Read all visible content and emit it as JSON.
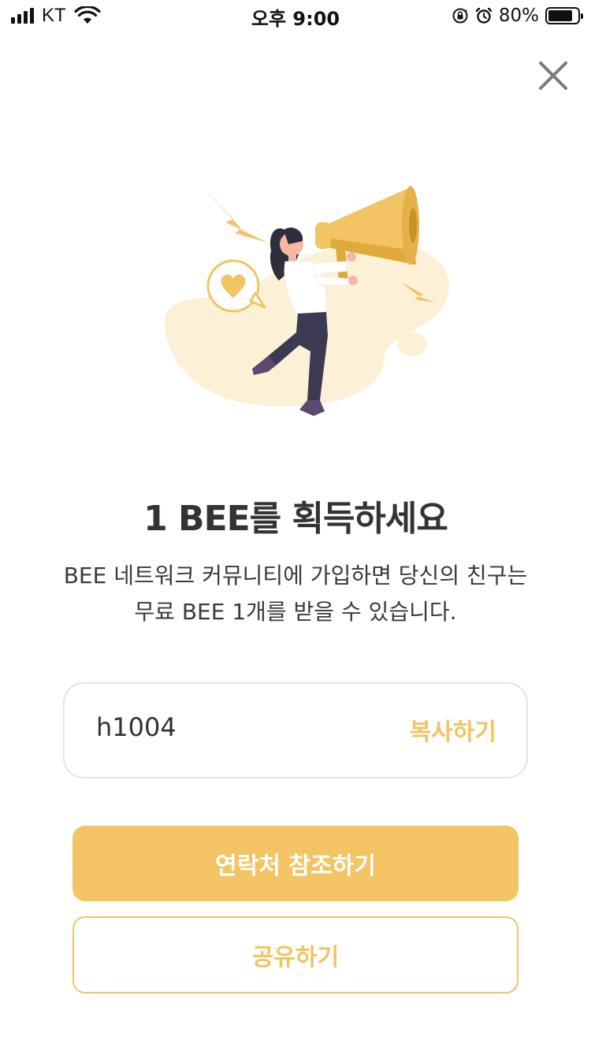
{
  "status_bar": {
    "carrier": "KT",
    "time": "오후 9:00",
    "battery_percent": "80%"
  },
  "icons": {
    "close": "close-icon",
    "signal": "signal-icon",
    "wifi": "wifi-icon",
    "orientation_lock": "orientation-lock-icon",
    "alarm": "alarm-icon",
    "battery": "battery-icon"
  },
  "content": {
    "title": "1 BEE를 획득하세요",
    "description": "BEE 네트워크 커뮤니티에 가입하면 당신의 친구는 무료 BEE 1개를 받을 수 있습니다."
  },
  "referral": {
    "code": "h1004",
    "copy_label": "복사하기"
  },
  "actions": {
    "contacts_label": "연락처 참조하기",
    "share_label": "공유하기"
  },
  "colors": {
    "accent": "#f2c463",
    "text": "#333333",
    "border": "#e4e4e4"
  }
}
